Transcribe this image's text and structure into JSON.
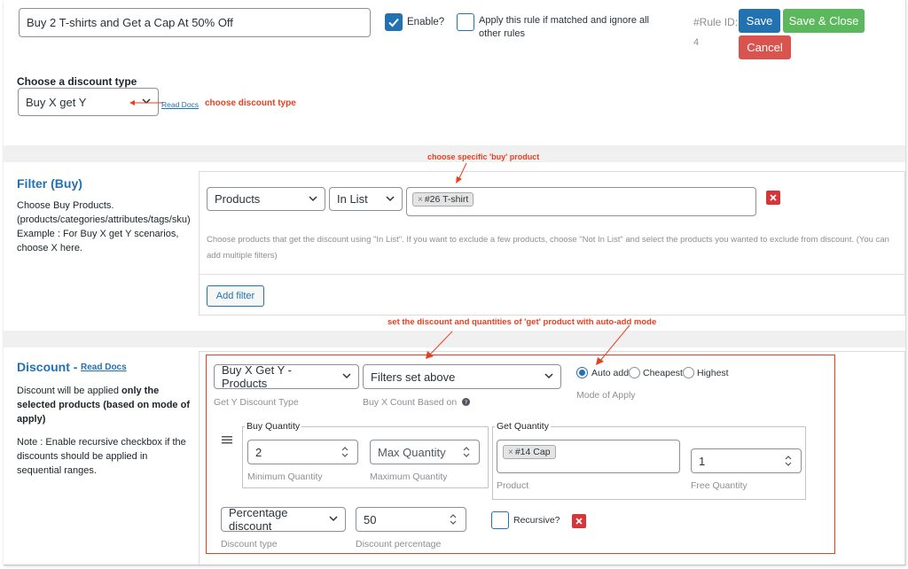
{
  "top": {
    "rule_title": "Buy 2 T-shirts and Get a Cap At 50% Off",
    "enable_label": "Enable?",
    "enable_checked": true,
    "exclusive_label": "Apply this rule if matched and ignore all other rules",
    "rule_id_label": "#Rule ID:",
    "rule_id_value": "4",
    "save_label": "Save",
    "save_close_label": "Save & Close",
    "cancel_label": "Cancel"
  },
  "discount_type": {
    "label": "Choose a discount type",
    "selected": "Buy X get Y",
    "read_docs": "Read Docs",
    "annotation": "choose discount type"
  },
  "filter": {
    "title": "Filter (Buy)",
    "description": "Choose Buy Products. (products/categories/attributes/tags/sku) Example : For Buy X get Y scenarios, choose X here.",
    "annotation": "choose specific 'buy' product",
    "type_selected": "Products",
    "condition_selected": "In List",
    "chip_label": "#26 T-shirt",
    "help": "Choose products that get the discount using \"In List\". If you want to exclude a few products, choose \"Not In List\" and select the products you wanted to exclude from discount. (You can add multiple filters)",
    "add_filter_label": "Add filter"
  },
  "discount": {
    "title": "Discount -",
    "read_docs": "Read Docs",
    "desc_pre": "Discount will be applied ",
    "desc_bold": "only the selected products (based on mode of apply)",
    "note": "Note : Enable recursive checkbox if the discounts should be applied in sequential ranges.",
    "annotation": "set the discount and quantities of 'get' product with auto-add mode",
    "get_type_selected": "Buy X Get Y - Products",
    "get_type_caption": "Get Y Discount Type",
    "count_selected": "Filters set above",
    "count_caption": "Buy X Count Based on",
    "mode_options": [
      "Auto add",
      "Cheapest",
      "Highest"
    ],
    "mode_selected": "Auto add",
    "mode_caption": "Mode of Apply",
    "buy_qty_legend": "Buy Quantity",
    "min_qty_value": "2",
    "min_qty_caption": "Minimum Quantity",
    "max_qty_placeholder": "Max Quantity",
    "max_qty_caption": "Maximum Quantity",
    "get_qty_legend": "Get Quantity",
    "product_chip": "#14 Cap",
    "product_caption": "Product",
    "free_qty_value": "1",
    "free_qty_caption": "Free Quantity",
    "discount_type_selected": "Percentage discount",
    "discount_type_caption": "Discount type",
    "discount_percent_value": "50",
    "discount_percent_caption": "Discount percentage",
    "recursive_label": "Recursive?"
  },
  "colors": {
    "primary": "#2271b1",
    "success": "#5cb85c",
    "danger": "#d9534f",
    "annotation": "#e8401e"
  }
}
